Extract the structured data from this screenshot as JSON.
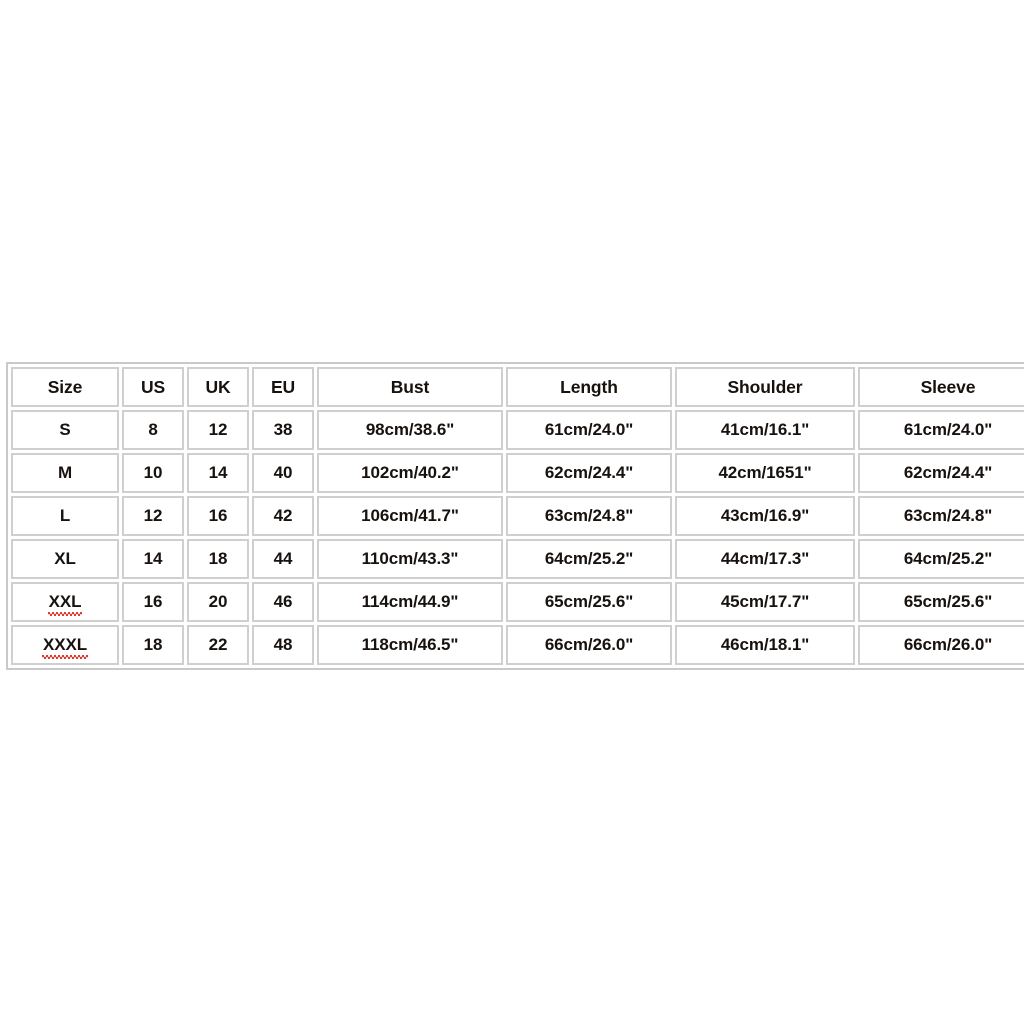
{
  "page": {
    "background_color": "#ffffff",
    "table_border_color": "#c9c9c9",
    "cell_border_color": "#cfcfcf",
    "text_color": "#18120f",
    "spellcheck_underline_color": "#e03b2f"
  },
  "chart_data": {
    "type": "table",
    "title": "",
    "columns": [
      "Size",
      "US",
      "UK",
      "EU",
      "Bust",
      "Length",
      "Shoulder",
      "Sleeve"
    ],
    "rows": [
      [
        "S",
        "8",
        "12",
        "38",
        "98cm/38.6\"",
        "61cm/24.0\"",
        "41cm/16.1\"",
        "61cm/24.0\""
      ],
      [
        "M",
        "10",
        "14",
        "40",
        "102cm/40.2\"",
        "62cm/24.4\"",
        "42cm/1651\"",
        "62cm/24.4\""
      ],
      [
        "L",
        "12",
        "16",
        "42",
        "106cm/41.7\"",
        "63cm/24.8\"",
        "43cm/16.9\"",
        "63cm/24.8\""
      ],
      [
        "XL",
        "14",
        "18",
        "44",
        "110cm/43.3\"",
        "64cm/25.2\"",
        "44cm/17.3\"",
        "64cm/25.2\""
      ],
      [
        "XXL",
        "16",
        "20",
        "46",
        "114cm/44.9\"",
        "65cm/25.6\"",
        "45cm/17.7\"",
        "65cm/25.6\""
      ],
      [
        "XXXL",
        "18",
        "22",
        "48",
        "118cm/46.5\"",
        "66cm/26.0\"",
        "46cm/18.1\"",
        "66cm/26.0\""
      ]
    ],
    "misspelled_cells": [
      "XXL",
      "XXXL"
    ]
  },
  "size_chart": {
    "headers": {
      "size": "Size",
      "us": "US",
      "uk": "UK",
      "eu": "EU",
      "bust": "Bust",
      "length": "Length",
      "shoulder": "Shoulder",
      "sleeve": "Sleeve"
    },
    "rows": [
      {
        "size": "S",
        "us": "8",
        "uk": "12",
        "eu": "38",
        "bust": "98cm/38.6\"",
        "length": "61cm/24.0\"",
        "shoulder": "41cm/16.1\"",
        "sleeve": "61cm/24.0\"",
        "misspelled": false
      },
      {
        "size": "M",
        "us": "10",
        "uk": "14",
        "eu": "40",
        "bust": "102cm/40.2\"",
        "length": "62cm/24.4\"",
        "shoulder": "42cm/1651\"",
        "sleeve": "62cm/24.4\"",
        "misspelled": false
      },
      {
        "size": "L",
        "us": "12",
        "uk": "16",
        "eu": "42",
        "bust": "106cm/41.7\"",
        "length": "63cm/24.8\"",
        "shoulder": "43cm/16.9\"",
        "sleeve": "63cm/24.8\"",
        "misspelled": false
      },
      {
        "size": "XL",
        "us": "14",
        "uk": "18",
        "eu": "44",
        "bust": "110cm/43.3\"",
        "length": "64cm/25.2\"",
        "shoulder": "44cm/17.3\"",
        "sleeve": "64cm/25.2\"",
        "misspelled": false
      },
      {
        "size": "XXL",
        "us": "16",
        "uk": "20",
        "eu": "46",
        "bust": "114cm/44.9\"",
        "length": "65cm/25.6\"",
        "shoulder": "45cm/17.7\"",
        "sleeve": "65cm/25.6\"",
        "misspelled": true
      },
      {
        "size": "XXXL",
        "us": "18",
        "uk": "22",
        "eu": "48",
        "bust": "118cm/46.5\"",
        "length": "66cm/26.0\"",
        "shoulder": "46cm/18.1\"",
        "sleeve": "66cm/26.0\"",
        "misspelled": true
      }
    ]
  }
}
